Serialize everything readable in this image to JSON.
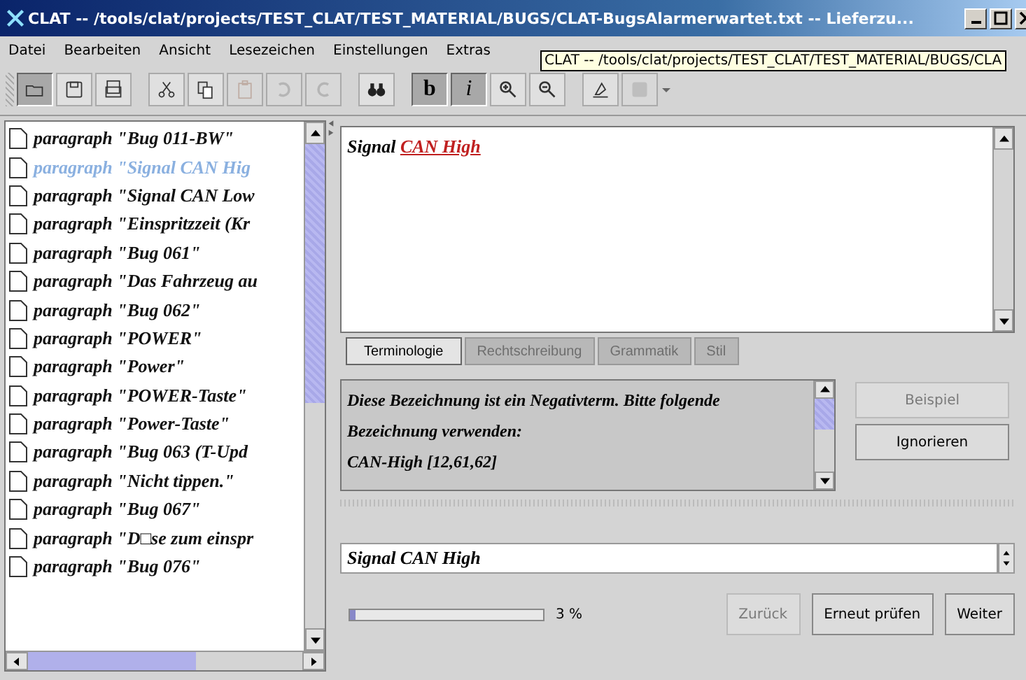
{
  "window": {
    "title": "CLAT -- /tools/clat/projects/TEST_CLAT/TEST_MATERIAL/BUGS/CLAT-BugsAlarmerwartet.txt -- Lieferzu..."
  },
  "menu": [
    "Datei",
    "Bearbeiten",
    "Ansicht",
    "Lesezeichen",
    "Einstellungen",
    "Extras"
  ],
  "tooltip": "CLAT -- /tools/clat/projects/TEST_CLAT/TEST_MATERIAL/BUGS/CLA",
  "toolbar": [
    {
      "kind": "open",
      "disabled": false,
      "pressed": true
    },
    {
      "kind": "save",
      "disabled": false,
      "pressed": false
    },
    {
      "kind": "save-all",
      "disabled": false,
      "pressed": false
    },
    {
      "kind": "sep"
    },
    {
      "kind": "cut",
      "disabled": false,
      "pressed": false
    },
    {
      "kind": "copy",
      "disabled": false,
      "pressed": false
    },
    {
      "kind": "paste",
      "disabled": true,
      "pressed": false
    },
    {
      "kind": "undo",
      "disabled": true,
      "pressed": false
    },
    {
      "kind": "redo",
      "disabled": true,
      "pressed": false
    },
    {
      "kind": "sep"
    },
    {
      "kind": "find",
      "disabled": false,
      "pressed": false
    },
    {
      "kind": "sep"
    },
    {
      "kind": "text",
      "label": "b",
      "disabled": false,
      "pressed": true
    },
    {
      "kind": "text",
      "label": "i",
      "disabled": false,
      "pressed": true
    },
    {
      "kind": "zoom-in",
      "disabled": false,
      "pressed": false
    },
    {
      "kind": "zoom-out",
      "disabled": false,
      "pressed": false
    },
    {
      "kind": "sep"
    },
    {
      "kind": "check",
      "disabled": false
    },
    {
      "kind": "stop",
      "disabled": true,
      "pressed": false
    }
  ],
  "tree": {
    "items": [
      {
        "label": "paragraph \"Bug 011-BW\"",
        "selected": false
      },
      {
        "label": "paragraph \"Signal CAN Hig",
        "selected": true
      },
      {
        "label": "paragraph \"Signal CAN Low",
        "selected": false
      },
      {
        "label": "paragraph \"Einspritzzeit (Kr",
        "selected": false
      },
      {
        "label": "paragraph \"Bug 061\"",
        "selected": false
      },
      {
        "label": "paragraph \"Das Fahrzeug au",
        "selected": false
      },
      {
        "label": "paragraph \"Bug 062\"",
        "selected": false
      },
      {
        "label": "paragraph \"POWER\"",
        "selected": false
      },
      {
        "label": "paragraph \"Power\"",
        "selected": false
      },
      {
        "label": "paragraph \"POWER-Taste\"",
        "selected": false
      },
      {
        "label": "paragraph \"Power-Taste\"",
        "selected": false
      },
      {
        "label": "paragraph \"Bug 063 (T-Upd",
        "selected": false
      },
      {
        "label": "paragraph \"Nicht tippen.\"",
        "selected": false
      },
      {
        "label": "paragraph \"Bug 067\"",
        "selected": false
      },
      {
        "label": "paragraph \"D□se zum einspr",
        "selected": false
      },
      {
        "label": "paragraph \"Bug 076\"",
        "selected": false
      }
    ]
  },
  "editor": {
    "segments": [
      {
        "text": "Signal",
        "kind": "plain"
      },
      {
        "text": "CAN High",
        "kind": "flagged"
      }
    ]
  },
  "tabs": [
    {
      "label": "Terminologie",
      "selected": true,
      "disabled": false
    },
    {
      "label": "Rechtschreibung",
      "selected": false,
      "disabled": true
    },
    {
      "label": "Grammatik",
      "selected": false,
      "disabled": true
    },
    {
      "label": "Stil",
      "selected": false,
      "disabled": true
    }
  ],
  "message": {
    "lines": [
      "Diese Bezeichnung ist ein Negativterm. Bitte folgende",
      "Bezeichnung verwenden:",
      "CAN-High [12,61,62]"
    ]
  },
  "side_buttons": [
    {
      "label": "Beispiel",
      "disabled": true
    },
    {
      "label": "Ignorieren",
      "disabled": false
    }
  ],
  "field": {
    "value": "Signal CAN High"
  },
  "progress": {
    "level": 0.03,
    "reading": "3 %"
  },
  "buttons": [
    {
      "label": "Zurück",
      "disabled": true
    },
    {
      "label": "Erneut prüfen",
      "disabled": false
    },
    {
      "label": "Weiter",
      "disabled": false
    }
  ]
}
